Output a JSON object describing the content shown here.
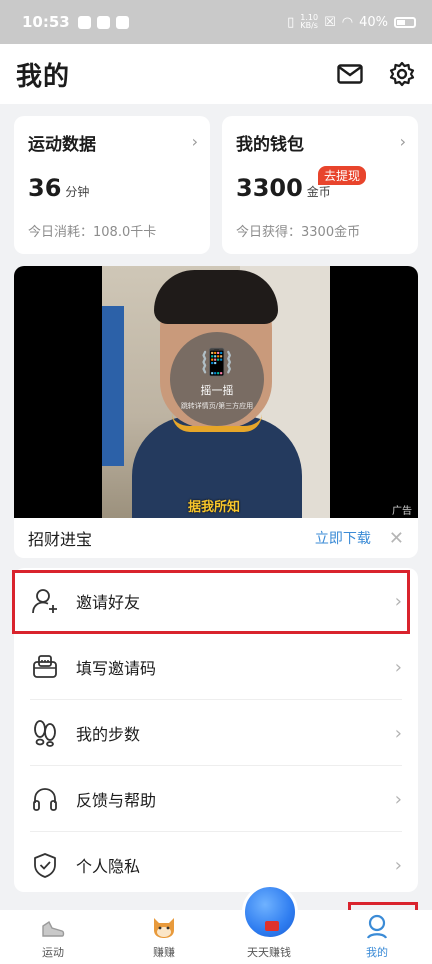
{
  "status_bar": {
    "time": "10:53",
    "net_speed_value": "1.10",
    "net_speed_unit": "KB/s",
    "battery": "40%"
  },
  "header": {
    "title": "我的",
    "mail_icon": "mail-icon",
    "settings_icon": "gear-icon"
  },
  "sport_card": {
    "title": "运动数据",
    "value": "36",
    "unit": "分钟",
    "subtitle": "今日消耗：108.0千卡"
  },
  "wallet_card": {
    "title": "我的钱包",
    "value": "3300",
    "unit": "金币",
    "badge": "去提现",
    "subtitle": "今日获得：3300金币"
  },
  "ad": {
    "shake_title": "摇一摇",
    "shake_sub": "跳转详情页/第三方应用",
    "caption": "据我所知",
    "ad_tag": "广告",
    "app_name": "招财进宝",
    "download": "立即下载",
    "close": "✕"
  },
  "menu": {
    "items": [
      {
        "label": "邀请好友",
        "icon": "add-user-icon"
      },
      {
        "label": "填写邀请码",
        "icon": "invite-code-icon"
      },
      {
        "label": "我的步数",
        "icon": "footprints-icon"
      },
      {
        "label": "反馈与帮助",
        "icon": "headphones-icon"
      },
      {
        "label": "个人隐私",
        "icon": "shield-check-icon"
      }
    ]
  },
  "tabbar": {
    "tabs": [
      {
        "label": "运动",
        "icon": "shoe-icon"
      },
      {
        "label": "赚赚",
        "icon": "shiba-icon"
      },
      {
        "label": "天天赚钱",
        "icon": "money-ball-icon"
      },
      {
        "label": "我的",
        "icon": "profile-icon",
        "active": true
      }
    ]
  },
  "colors": {
    "accent": "#3b8bd6",
    "badge": "#e8442c",
    "highlight": "#d9232d"
  }
}
